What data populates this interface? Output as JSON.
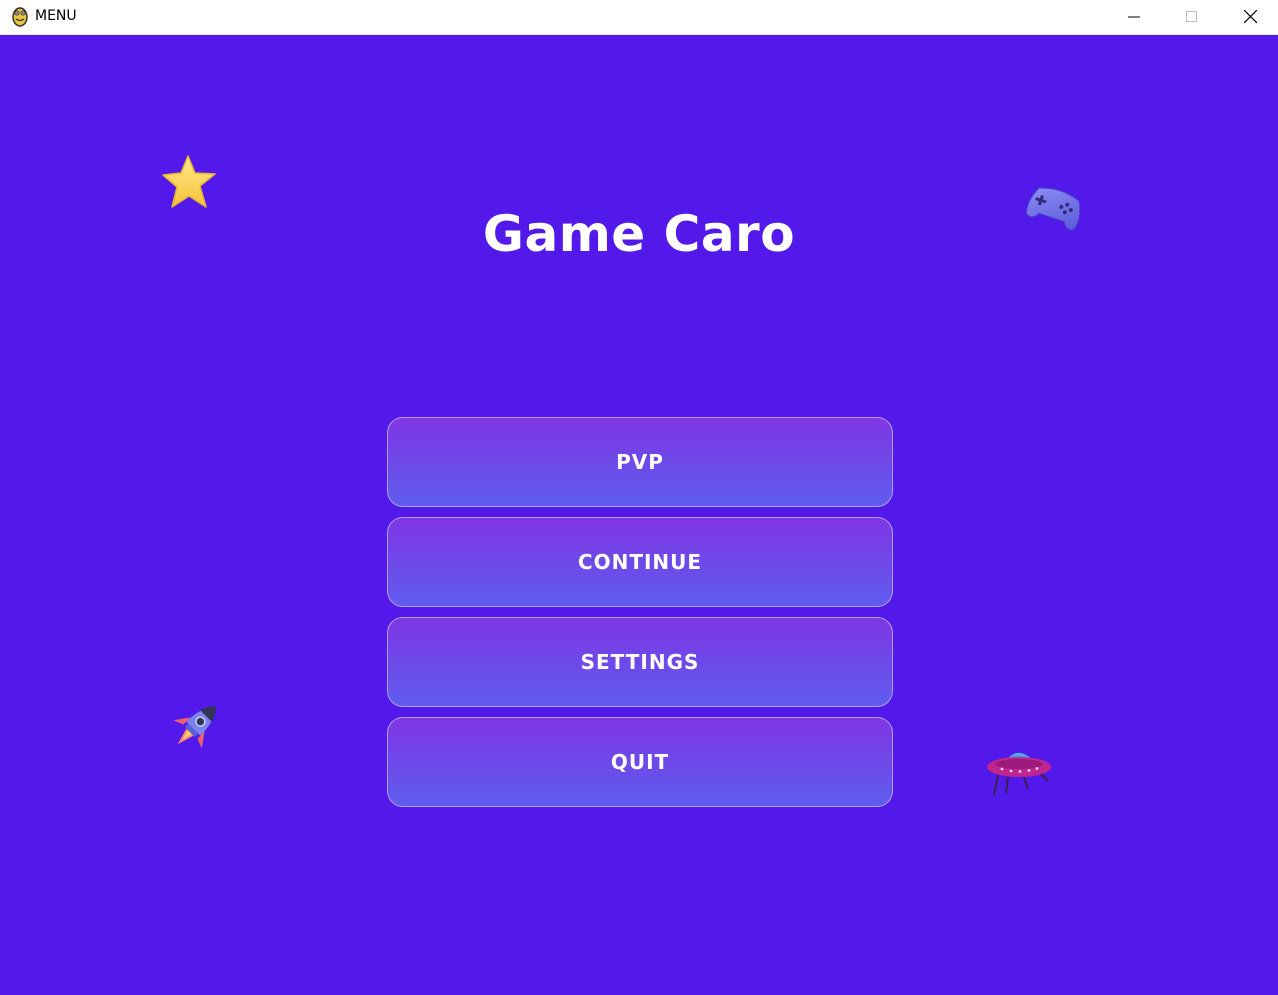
{
  "window": {
    "title": "MENU",
    "app_icon": "python-snake-icon",
    "controls": [
      "minimize-icon",
      "maximize-icon",
      "close-icon"
    ]
  },
  "game": {
    "title": "Game Caro",
    "background_color": "#5219ea",
    "menu": [
      {
        "label": "PVP"
      },
      {
        "label": "CONTINUE"
      },
      {
        "label": "SETTINGS"
      },
      {
        "label": "QUIT"
      }
    ],
    "decorations": [
      "star-icon",
      "gamepad-icon",
      "rocket-icon",
      "ufo-icon"
    ]
  }
}
